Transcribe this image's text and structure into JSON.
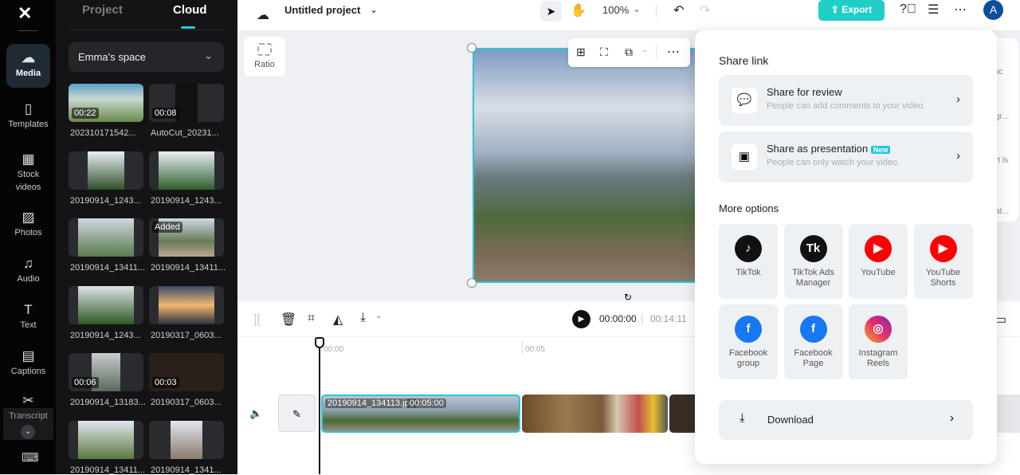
{
  "rail": {
    "items": [
      {
        "label": "Media",
        "icon": "cloud-upload-icon"
      },
      {
        "label": "Templates",
        "icon": "templates-icon"
      },
      {
        "label": "Stock videos",
        "icon": "film-icon"
      },
      {
        "label": "Photos",
        "icon": "photo-icon"
      },
      {
        "label": "Audio",
        "icon": "music-icon"
      },
      {
        "label": "Text",
        "icon": "text-icon"
      },
      {
        "label": "Captions",
        "icon": "captions-icon"
      },
      {
        "label": "Transcript",
        "icon": "transcript-icon"
      }
    ]
  },
  "panel": {
    "tabs": [
      "Project",
      "Cloud"
    ],
    "active_tab": "Cloud",
    "space": "Emma’s space",
    "media": [
      {
        "name": "202310171542...",
        "duration": "00:22"
      },
      {
        "name": "AutoCut_20231...",
        "duration": "00:08"
      },
      {
        "name": "20190914_1243..."
      },
      {
        "name": "20190914_1243..."
      },
      {
        "name": "20190914_13411..."
      },
      {
        "name": "20190914_13411...",
        "badge": "Added"
      },
      {
        "name": "20190914_1243..."
      },
      {
        "name": "20190317_0603..."
      },
      {
        "name": "20190914_13183...",
        "duration": "00:06"
      },
      {
        "name": "20190317_0603...",
        "duration": "00:03"
      },
      {
        "name": "20190914_13411..."
      },
      {
        "name": "20190914_1341..."
      }
    ]
  },
  "topbar": {
    "title": "Untitled project",
    "zoom": "100%",
    "export": "Export",
    "avatar": "A"
  },
  "canvas": {
    "ratio": "Ratio",
    "side_fragments": [
      "ic",
      "gr...",
      "rt ls",
      "at..."
    ]
  },
  "timeline": {
    "current": "00:00:00",
    "total": "00:14:11",
    "ticks": [
      "00:00",
      "00:05"
    ],
    "clip_name": "20190914_134113.jpg",
    "clip_duration": "00:05:00"
  },
  "popup": {
    "title": "Share link",
    "review_title": "Share for review",
    "review_sub": "People can add comments to your video.",
    "present_title": "Share as presentation",
    "present_badge": "New",
    "present_sub": "People can only watch your video.",
    "more": "More options",
    "options": [
      {
        "label": "TikTok",
        "color": "#111111"
      },
      {
        "label": "TikTok Ads Manager",
        "color": "#111111"
      },
      {
        "label": "YouTube",
        "color": "#ff0000"
      },
      {
        "label": "YouTube Shorts",
        "color": "#ff0000"
      },
      {
        "label": "Facebook group",
        "color": "#1877f2"
      },
      {
        "label": "Facebook Page",
        "color": "#1877f2"
      },
      {
        "label": "Instagram Reels",
        "color": "#e1306c"
      }
    ],
    "download": "Download"
  },
  "colors": {
    "accent": "#22d3c5",
    "export_bg": "#1fcfc5",
    "selection": "#27c6d9"
  }
}
